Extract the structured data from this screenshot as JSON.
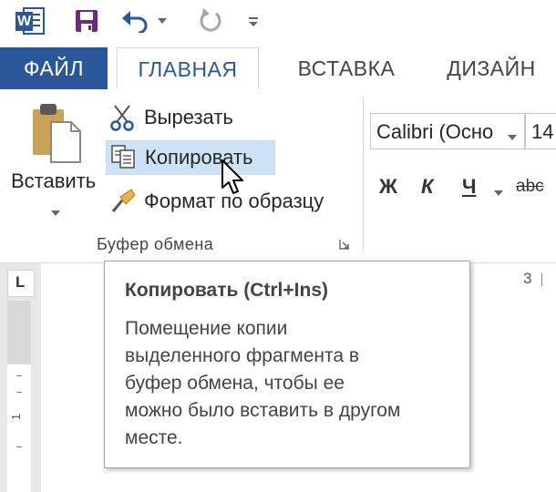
{
  "quick_access": {
    "app_icon": "word-icon",
    "app_letter": "W",
    "buttons": [
      {
        "name": "save-icon"
      },
      {
        "name": "undo-icon"
      },
      {
        "name": "redo-icon"
      },
      {
        "name": "customize-icon"
      }
    ]
  },
  "tabs": {
    "file": "ФАЙЛ",
    "home": "ГЛАВНАЯ",
    "insert": "ВСТАВКА",
    "design": "ДИЗАЙН"
  },
  "clipboard": {
    "paste_label": "Вставить",
    "cut_label": "Вырезать",
    "copy_label": "Копировать",
    "format_painter_label": "Формат по образцу",
    "group_label": "Буфер обмена"
  },
  "font": {
    "font_name": "Calibri (Осно",
    "font_size": "14",
    "bold": "Ж",
    "italic": "К",
    "underline": "Ч",
    "strikethrough": "abc"
  },
  "ruler": {
    "tab_selector": "L",
    "vertical_mark": "1",
    "horizontal_mark": "3"
  },
  "tooltip": {
    "title": "Копировать (Ctrl+Ins)",
    "lines": [
      "Помещение копии",
      "выделенного фрагмента в",
      "буфер обмена, чтобы ее",
      "можно было вставить в другом",
      "месте."
    ]
  },
  "colors": {
    "word_blue": "#2b579a",
    "hover_blue": "#cde3f5",
    "text": "#262626"
  }
}
